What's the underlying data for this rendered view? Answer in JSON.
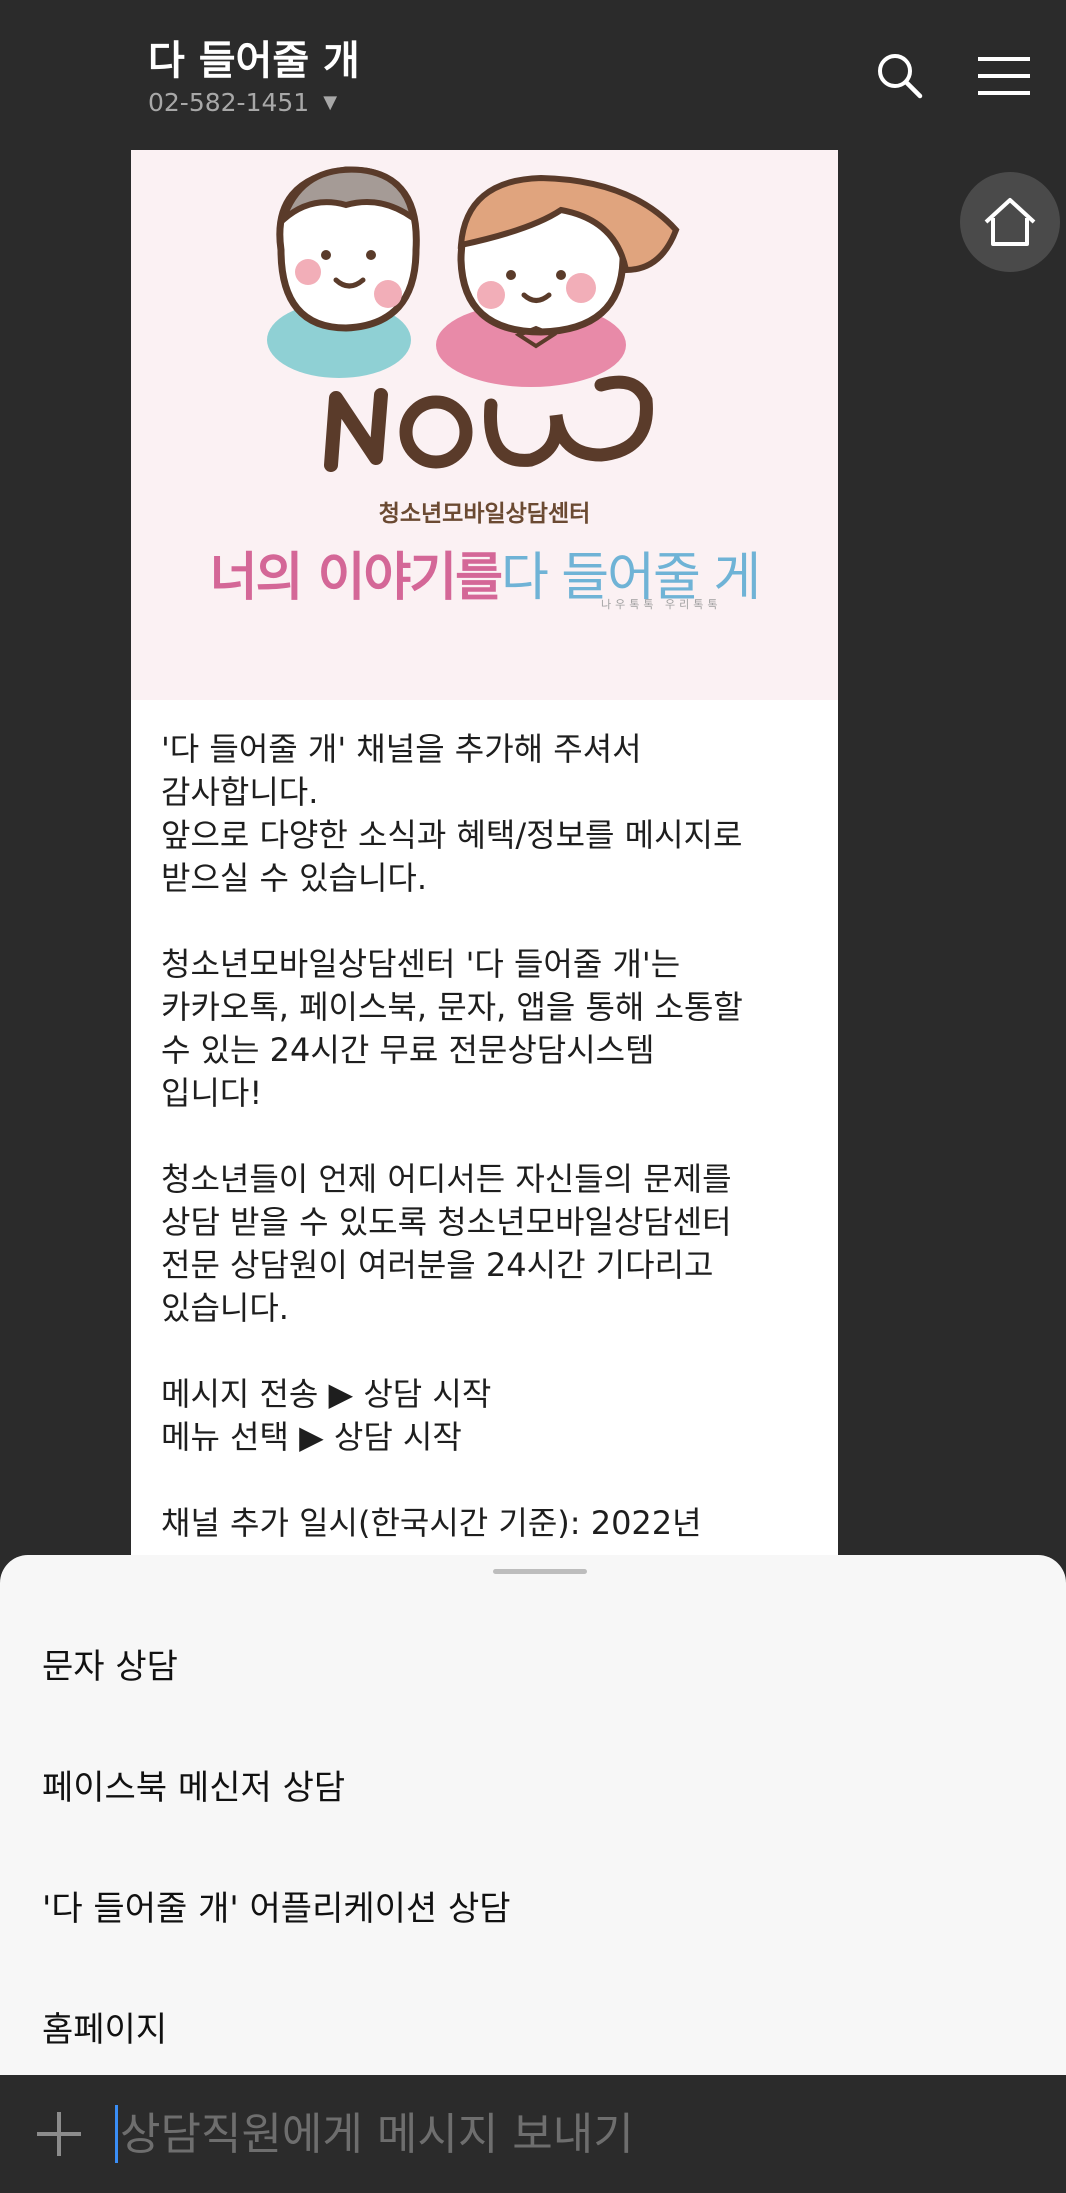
{
  "header": {
    "title": "다 들어줄 개",
    "phone": "02-582-1451"
  },
  "banner": {
    "logo_word": "NOW",
    "center_name": "청소년모바일상담센터",
    "slogan_pink": "너의 이야기를",
    "slogan_blue": "다 들어줄 게",
    "tiny_text": "나우톡톡 우리톡톡"
  },
  "message": {
    "paragraphs": [
      "'다 들어줄 개' 채널을 추가해 주셔서\n감사합니다.\n앞으로 다양한 소식과 혜택/정보를 메시지로\n받으실 수 있습니다.",
      "청소년모바일상담센터 '다 들어줄 개'는\n카카오톡, 페이스북, 문자, 앱을 통해 소통할\n수 있는 24시간 무료 전문상담시스템\n입니다!",
      "청소년들이 언제 어디서든 자신들의 문제를\n상담 받을 수 있도록 청소년모바일상담센터\n전문 상담원이 여러분을 24시간 기다리고\n있습니다.",
      "메시지 전송 ▶ 상담 시작\n메뉴 선택 ▶ 상담 시작",
      "채널 추가 일시(한국시간 기준): 2022년"
    ]
  },
  "sheet": {
    "items": [
      "문자 상담",
      "페이스북 메신저 상담",
      "'다 들어줄 개' 어플리케이션 상담",
      "홈페이지"
    ]
  },
  "input": {
    "placeholder": "상담직원에게 메시지 보내기"
  },
  "icons": {
    "search": "search-icon",
    "menu": "hamburger-menu-icon",
    "home": "home-icon",
    "plus": "plus-icon"
  },
  "colors": {
    "background": "#2b2b2b",
    "sheet": "#f7f7f7",
    "banner_pink": "#d46797",
    "banner_blue": "#6fb3d6",
    "cursor": "#3a8ef6"
  }
}
